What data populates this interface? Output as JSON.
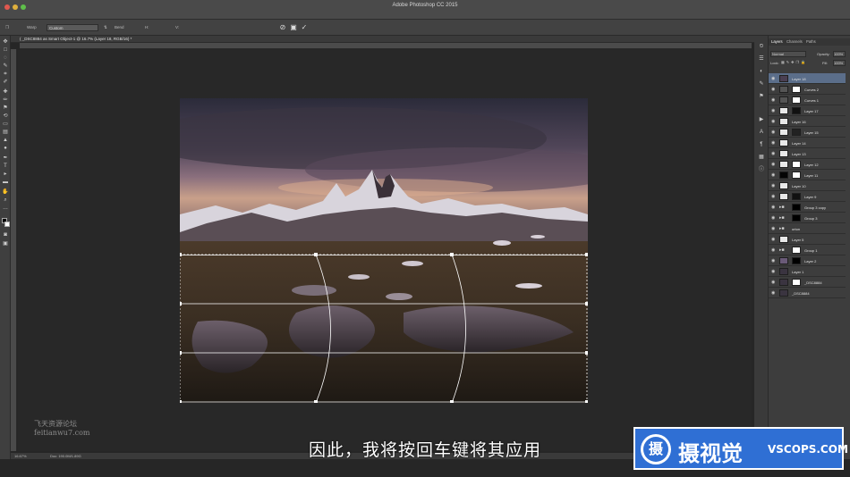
{
  "app": {
    "title": "Adobe Photoshop CC 2015"
  },
  "options_bar": {
    "warp_label": "Warp",
    "warp_value": "Custom",
    "bend_label": "Bend",
    "cancel_icon": "cancel-icon",
    "commit_icon": "commit-icon"
  },
  "document": {
    "tab_title": "( _DSC8884 as Smart Object-1 @ 16.7% (Layer 18, RGB/16) *",
    "zoom": "16.67%",
    "doc_info": "Doc: 190.0M/1.89G"
  },
  "layers_panel": {
    "tabs": [
      "Layers",
      "Channels",
      "Paths"
    ],
    "blend_mode": "Normal",
    "opacity_label": "Opacity:",
    "opacity_value": "100%",
    "lock_label": "Lock:",
    "fill_label": "Fill:",
    "fill_value": "100%",
    "layers": [
      {
        "name": "Layer 18",
        "thumb": "#4a3f52",
        "mask": "",
        "group": false,
        "selected": true
      },
      {
        "name": "Curves 2",
        "thumb": "#555555",
        "mask": "#ffffff",
        "group": false,
        "selected": false
      },
      {
        "name": "Curves 1",
        "thumb": "#555555",
        "mask": "#ffffff",
        "group": false,
        "selected": false
      },
      {
        "name": "Layer 17",
        "thumb": "#e8e8e8",
        "mask": "#111111",
        "group": false,
        "selected": false
      },
      {
        "name": "Layer 16",
        "thumb": "#e8e8e8",
        "mask": "",
        "group": false,
        "selected": false
      },
      {
        "name": "Layer 15",
        "thumb": "#e8e8e8",
        "mask": "#222222",
        "group": false,
        "selected": false
      },
      {
        "name": "Layer 14",
        "thumb": "#e8e8e8",
        "mask": "",
        "group": false,
        "selected": false
      },
      {
        "name": "Layer 13",
        "thumb": "#e8e8e8",
        "mask": "",
        "group": false,
        "selected": false
      },
      {
        "name": "Layer 12",
        "thumb": "#e8e8e8",
        "mask": "#ffffff",
        "group": false,
        "selected": false
      },
      {
        "name": "Layer 11",
        "thumb": "#050505",
        "mask": "#ffffff",
        "group": false,
        "selected": false
      },
      {
        "name": "Layer 10",
        "thumb": "#e8e8e8",
        "mask": "",
        "group": false,
        "selected": false
      },
      {
        "name": "Layer 9",
        "thumb": "#e8e8e8",
        "mask": "#111111",
        "group": false,
        "selected": false
      },
      {
        "name": "Group 3 copy",
        "thumb": "",
        "mask": "#000000",
        "group": true,
        "selected": false
      },
      {
        "name": "Group 3",
        "thumb": "",
        "mask": "#000000",
        "group": true,
        "selected": false
      },
      {
        "name": "orton",
        "thumb": "",
        "mask": "",
        "group": true,
        "selected": false
      },
      {
        "name": "Layer 5",
        "thumb": "#e8e8e8",
        "mask": "",
        "group": false,
        "selected": false
      },
      {
        "name": "Group 1",
        "thumb": "",
        "mask": "#ffffff",
        "group": true,
        "selected": false
      },
      {
        "name": "Layer 2",
        "thumb": "#6a5a78",
        "mask": "#000000",
        "group": false,
        "selected": false
      },
      {
        "name": "Layer 1",
        "thumb": "#3a3440",
        "mask": "",
        "group": false,
        "selected": false
      },
      {
        "name": "_DSC8884",
        "thumb": "#3a3440",
        "mask": "#ffffff",
        "group": false,
        "selected": false
      },
      {
        "name": "_DSC8884",
        "thumb": "#3a3440",
        "mask": "",
        "group": false,
        "selected": false
      }
    ]
  },
  "overlay": {
    "subtitle": "因此，我将按回车键将其应用",
    "watermark_line1": "飞天资源论坛",
    "watermark_line2": "feitianwu7.com",
    "logo_text": "摄视觉",
    "logo_url": "VSCOPS.COM",
    "logo_glyph": "摄"
  },
  "colors": {
    "accent": "#2f6fd4",
    "selection": "#5b6e8a"
  }
}
